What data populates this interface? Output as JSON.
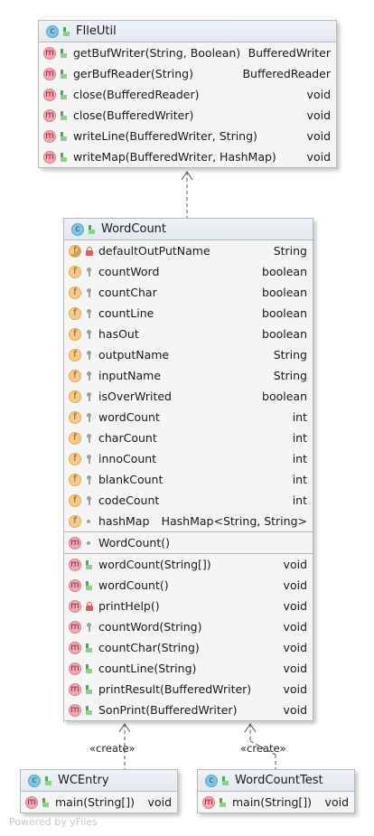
{
  "classes": {
    "fileutil": {
      "name": "FIleUtil",
      "methods": [
        {
          "label": "getBufWriter(String, Boolean)",
          "type": "BufferedWriter"
        },
        {
          "label": "gerBufReader(String)",
          "type": "BufferedReader"
        },
        {
          "label": "close(BufferedReader)",
          "type": "void"
        },
        {
          "label": "close(BufferedWriter)",
          "type": "void"
        },
        {
          "label": "writeLine(BufferedWriter, String)",
          "type": "void"
        },
        {
          "label": "writeMap(BufferedWriter, HashMap)",
          "type": "void"
        }
      ]
    },
    "wordcount": {
      "name": "WordCount",
      "fields": [
        {
          "label": "defaultOutPutName",
          "type": "String"
        },
        {
          "label": "countWord",
          "type": "boolean"
        },
        {
          "label": "countChar",
          "type": "boolean"
        },
        {
          "label": "countLine",
          "type": "boolean"
        },
        {
          "label": "hasOut",
          "type": "boolean"
        },
        {
          "label": "outputName",
          "type": "String"
        },
        {
          "label": "inputName",
          "type": "String"
        },
        {
          "label": "isOverWrited",
          "type": "boolean"
        },
        {
          "label": "wordCount",
          "type": "int"
        },
        {
          "label": "charCount",
          "type": "int"
        },
        {
          "label": "innoCount",
          "type": "int"
        },
        {
          "label": "blankCount",
          "type": "int"
        },
        {
          "label": "codeCount",
          "type": "int"
        },
        {
          "label": "hashMap",
          "type": "HashMap<String, String>"
        }
      ],
      "constructor": {
        "label": "WordCount()",
        "type": ""
      },
      "methods": [
        {
          "label": "wordCount(String[])",
          "type": "void"
        },
        {
          "label": "wordCount()",
          "type": "void"
        },
        {
          "label": "printHelp()",
          "type": "void"
        },
        {
          "label": "countWord(String)",
          "type": "void"
        },
        {
          "label": "countChar(String)",
          "type": "void"
        },
        {
          "label": "countLine(String)",
          "type": "void"
        },
        {
          "label": "printResult(BufferedWriter)",
          "type": "void"
        },
        {
          "label": "SonPrint(BufferedWriter)",
          "type": "void"
        }
      ]
    },
    "wcentry": {
      "name": "WCEntry",
      "methods": [
        {
          "label": "main(String[])",
          "type": "void"
        }
      ]
    },
    "wordcounttest": {
      "name": "WordCountTest",
      "methods": [
        {
          "label": "main(String[])",
          "type": "void"
        }
      ]
    }
  },
  "stereotypes": {
    "create_left": "«create»",
    "create_right": "«create»"
  },
  "icons": {
    "class": "c",
    "method": "m",
    "field": "f"
  },
  "watermark": "Powered by yFiles"
}
